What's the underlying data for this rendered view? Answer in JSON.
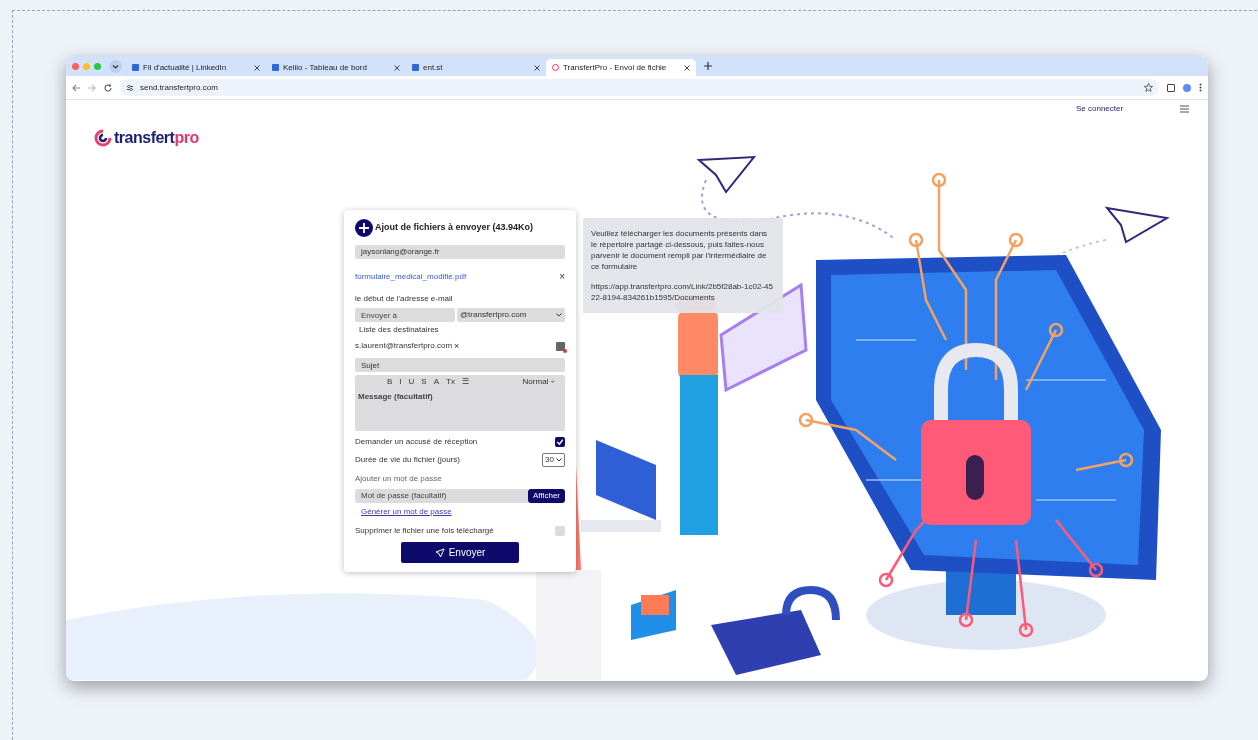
{
  "browser": {
    "tabs": [
      {
        "title": "Fil d'actualité | LinkedIn",
        "selected": false
      },
      {
        "title": "Keliio - Tableau de bord",
        "selected": false
      },
      {
        "title": "ent.st",
        "selected": false
      },
      {
        "title": "TransfertPro - Envoi de fichie",
        "selected": true
      }
    ],
    "address": "send.transfertpro.com"
  },
  "header": {
    "logo_text": "transfert",
    "logo_accent": "pro",
    "login_link": "Se connecter"
  },
  "form": {
    "title": "Ajout de fichiers à envoyer (43.94Ko)",
    "sender_email": "jaysonlang@orange.fr",
    "file": {
      "name": "formulaire_medical_modifié.pdf",
      "remove": "×"
    },
    "recipient_label": "le début de l'adresse e-mail",
    "recipient_placeholder": "Envoyer à",
    "domain": "@transfertpro.com",
    "recipients_label": "Liste des destinataires",
    "recipient": {
      "email": "s.laurent@transfertpro.com",
      "remove": "×"
    },
    "subject_placeholder": "Sujet",
    "toolbar": [
      "B",
      "I",
      "U",
      "S",
      "A",
      "Tx",
      "☰"
    ],
    "text_style": "Normal ÷",
    "message_placeholder": "Message (facultatif)",
    "options": [
      {
        "kind": "checkbox",
        "label": "Demander un accusé de réception",
        "checked": true
      },
      {
        "kind": "select",
        "label": "Durée de vie du fichier (jours)",
        "value": "30"
      }
    ],
    "password_label": "Ajouter un mot de passe",
    "password_placeholder": "Mot de passe (facultatif)",
    "show_button": "Afficher",
    "generate_link": "Générer un mot de passe",
    "delete_option": {
      "label": "Supprimer le fichier une fois téléchargé",
      "checked": false
    },
    "submit": "Envoyer"
  },
  "note": {
    "text": "Veuillez télécharger les documents présents dans le répertoire partagé ci-dessous, puis faites-nous parvenir le document rempli par l'intermédiaire de ce formulaire",
    "link": "https://app.transfertpro.com/Link/2b5f28ab-1c02-4522-8194-834261b1595/Documents"
  }
}
